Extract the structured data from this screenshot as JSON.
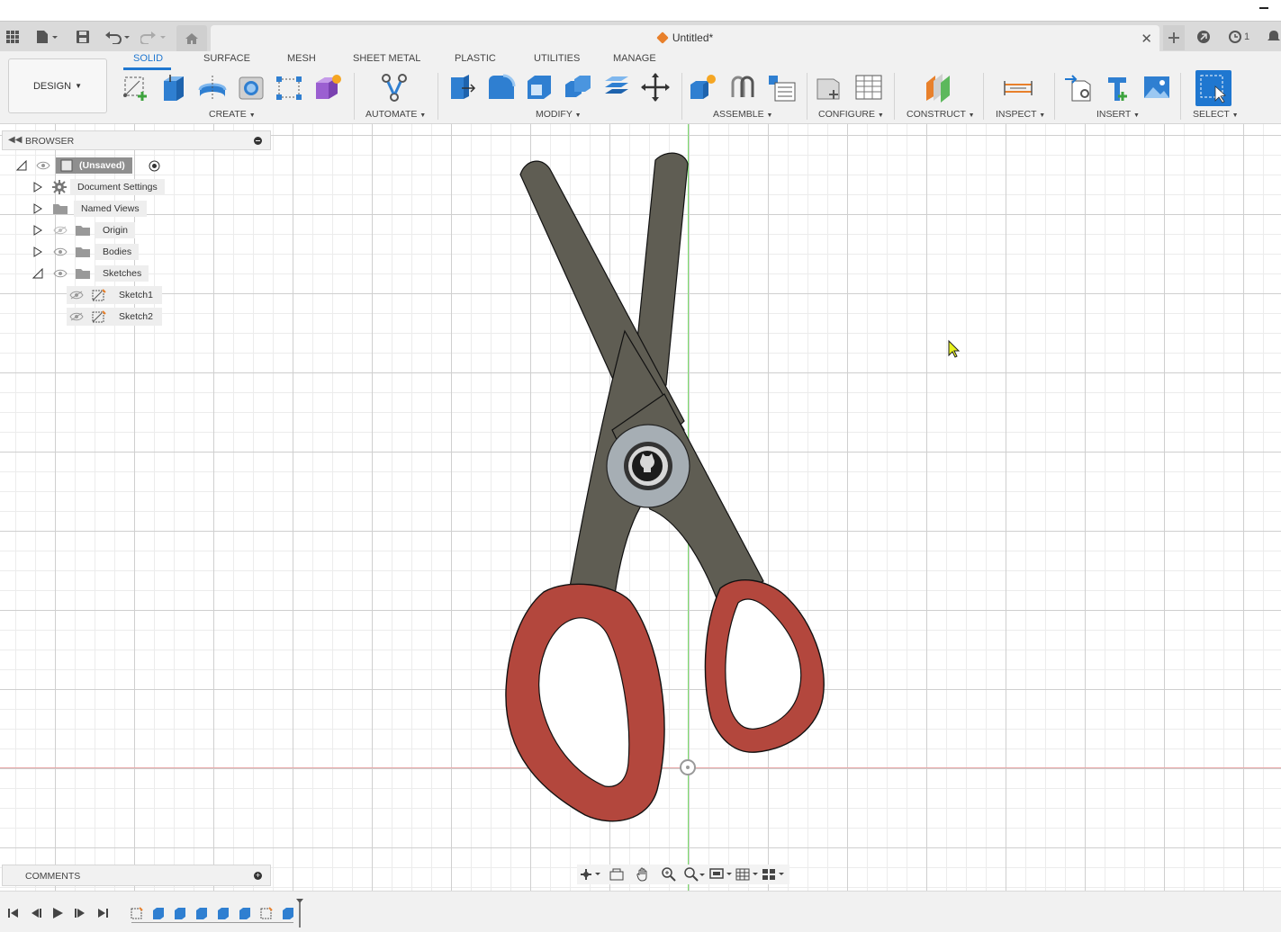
{
  "window": {
    "minimize_icon": "window-minimize-icon"
  },
  "titlebar": {
    "doc_title": "Untitled*",
    "notification_count": "1",
    "icons": [
      "app-grid-icon",
      "file-icon",
      "save-icon",
      "undo-icon",
      "redo-icon",
      "home-icon",
      "new-tab-icon",
      "extensions-icon",
      "job-status-icon",
      "notifications-icon"
    ]
  },
  "toolbar": {
    "design_label": "DESIGN",
    "tabs": [
      {
        "label": "SOLID",
        "active": true
      },
      {
        "label": "SURFACE",
        "active": false
      },
      {
        "label": "MESH",
        "active": false
      },
      {
        "label": "SHEET METAL",
        "active": false
      },
      {
        "label": "PLASTIC",
        "active": false
      },
      {
        "label": "UTILITIES",
        "active": false
      },
      {
        "label": "MANAGE",
        "active": false
      }
    ],
    "groups": {
      "create": "CREATE",
      "automate": "AUTOMATE",
      "modify": "MODIFY",
      "assemble": "ASSEMBLE",
      "configure": "CONFIGURE",
      "construct": "CONSTRUCT",
      "inspect": "INSPECT",
      "insert": "INSERT",
      "select": "SELECT"
    },
    "accent_color": "#1f77d0"
  },
  "browser": {
    "title": "BROWSER",
    "root": "(Unsaved)",
    "items": [
      {
        "label": "Document Settings"
      },
      {
        "label": "Named Views"
      },
      {
        "label": "Origin"
      },
      {
        "label": "Bodies"
      },
      {
        "label": "Sketches"
      },
      {
        "label": "Sketch1"
      },
      {
        "label": "Sketch2"
      }
    ]
  },
  "comments": {
    "title": "COMMENTS"
  },
  "model": {
    "blade_color": "#5f5d53",
    "handle_color": "#b3473d",
    "pivot_color": "#a6aeb4"
  },
  "navbar": {
    "icons": [
      "orbit-icon",
      "look-at-icon",
      "pan-icon",
      "zoom-icon",
      "zoom-window-icon",
      "display-settings-icon",
      "grid-settings-icon",
      "viewports-icon"
    ]
  },
  "timeline": {
    "controls": [
      "first-icon",
      "previous-icon",
      "play-icon",
      "next-icon",
      "last-icon"
    ]
  }
}
